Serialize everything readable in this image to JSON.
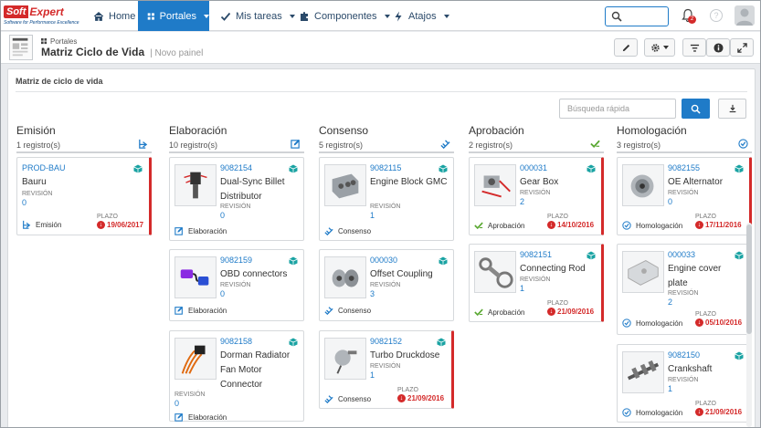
{
  "nav": {
    "home": "Home",
    "portals": "Portales",
    "tasks": "Mis tareas",
    "components": "Componentes",
    "shortcuts": "Atajos",
    "notif_count": "2"
  },
  "logo": {
    "soft": "Soft",
    "expert": "Expert",
    "tagline": "Software for Performance Excellence"
  },
  "header": {
    "breadcrumb": "Portales",
    "title": "Matriz Ciclo de Vida",
    "subtitle": "| Novo painel"
  },
  "panel": {
    "title": "Matriz de ciclo de vida",
    "search_placeholder": "Búsqueda rápida"
  },
  "colors": {
    "accent": "#1f7bc8",
    "late": "#d42a2a",
    "approve": "#5aa832"
  },
  "columns": [
    {
      "name": "Emisión",
      "count": "1 registro(s)",
      "icon": "emission-icon",
      "cards": [
        {
          "code": "PROD-BAU",
          "name": "Bauru",
          "rev_label": "REVISIÓN",
          "rev": "0",
          "stage": "Emisión",
          "plazo_label": "PLAZO",
          "due": "19/06/2017"
        }
      ]
    },
    {
      "name": "Elaboración",
      "count": "10 registro(s)",
      "icon": "elaboration-icon",
      "cards": [
        {
          "code": "9082154",
          "name": "Dual-Sync Billet Distributor",
          "rev_label": "REVISIÓN",
          "rev": "0",
          "stage": "Elaboración"
        },
        {
          "code": "9082159",
          "name": "OBD connectors",
          "rev_label": "REVISIÓN",
          "rev": "0",
          "stage": "Elaboración"
        },
        {
          "code": "9082158",
          "name": "Dorman Radiator Fan Motor Connector",
          "rev_label": "REVISIÓN",
          "rev": "0",
          "stage": "Elaboración"
        }
      ]
    },
    {
      "name": "Consenso",
      "count": "5 registro(s)",
      "icon": "consensus-icon",
      "cards": [
        {
          "code": "9082115",
          "name": "Engine Block GMC",
          "rev_label": "REVISIÓN",
          "rev": "1",
          "stage": "Consenso"
        },
        {
          "code": "000030",
          "name": "Offset Coupling",
          "rev_label": "REVISIÓN",
          "rev": "3",
          "stage": "Consenso"
        },
        {
          "code": "9082152",
          "name": "Turbo Druckdose",
          "rev_label": "REVISIÓN",
          "rev": "1",
          "stage": "Consenso",
          "plazo_label": "PLAZO",
          "due": "21/09/2016"
        }
      ]
    },
    {
      "name": "Aprobación",
      "count": "2 registro(s)",
      "icon": "approval-icon",
      "cards": [
        {
          "code": "000031",
          "name": "Gear Box",
          "rev_label": "REVISIÓN",
          "rev": "2",
          "stage": "Aprobación",
          "plazo_label": "PLAZO",
          "due": "14/10/2016"
        },
        {
          "code": "9082151",
          "name": "Connecting Rod",
          "rev_label": "REVISIÓN",
          "rev": "1",
          "stage": "Aprobación",
          "plazo_label": "PLAZO",
          "due": "21/09/2016"
        }
      ]
    },
    {
      "name": "Homologación",
      "count": "3 registro(s)",
      "icon": "homologation-icon",
      "cards": [
        {
          "code": "9082155",
          "name": "OE Alternator",
          "rev_label": "REVISIÓN",
          "rev": "0",
          "stage": "Homologación",
          "plazo_label": "PLAZO",
          "due": "17/11/2016"
        },
        {
          "code": "000033",
          "name": "Engine cover plate",
          "rev_label": "REVISIÓN",
          "rev": "2",
          "stage": "Homologación",
          "plazo_label": "PLAZO",
          "due": "05/10/2016"
        },
        {
          "code": "9082150",
          "name": "Crankshaft",
          "rev_label": "REVISIÓN",
          "rev": "1",
          "stage": "Homologación",
          "plazo_label": "PLAZO",
          "due": "21/09/2016"
        }
      ]
    }
  ]
}
